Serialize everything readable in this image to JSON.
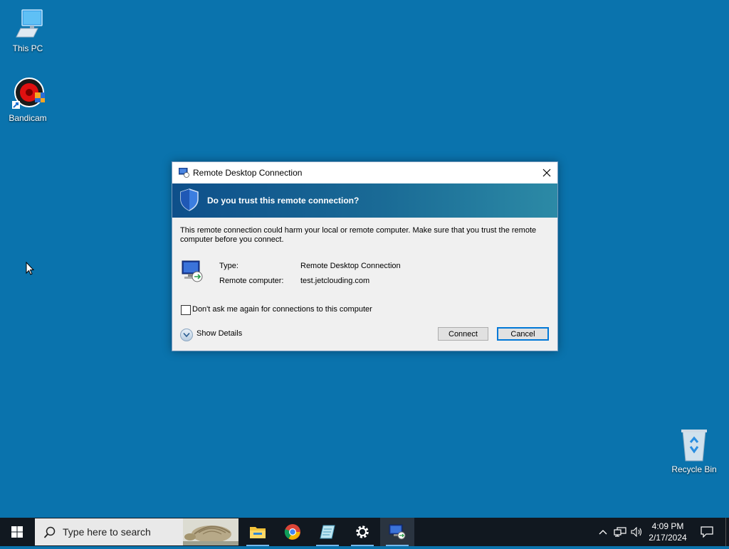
{
  "desktop": {
    "icons": [
      {
        "label": "This PC",
        "icon": "computer-icon"
      },
      {
        "label": "Bandicam",
        "icon": "bandicam-icon"
      },
      {
        "label": "Recycle Bin",
        "icon": "recycle-bin-icon"
      }
    ]
  },
  "dialog": {
    "title": "Remote Desktop Connection",
    "question": "Do you trust this remote connection?",
    "warning": "This remote connection could harm your local or remote computer. Make sure that you trust the remote computer before you connect.",
    "type_label": "Type:",
    "type_value": "Remote Desktop Connection",
    "remote_label": "Remote computer:",
    "remote_value": "test.jetclouding.com",
    "dont_ask_label": "Don't ask me again for connections to this computer",
    "dont_ask_checked": false,
    "show_details_label": "Show Details",
    "connect_label": "Connect",
    "cancel_label": "Cancel",
    "colors": {
      "banner_start": "#0e4f8a",
      "banner_end": "#2c8aa6",
      "focus_border": "#0078d7"
    }
  },
  "taskbar": {
    "search_placeholder": "Type here to search",
    "apps": [
      "file-explorer-icon",
      "chrome-icon",
      "notepad-icon",
      "settings-icon",
      "remote-desktop-icon"
    ],
    "active_app": "remote-desktop-icon",
    "time": "4:09 PM",
    "date": "2/17/2024"
  },
  "colors": {
    "desktop": "#0a73ad",
    "taskbar": "#111820",
    "accent": "#76b9ed"
  }
}
